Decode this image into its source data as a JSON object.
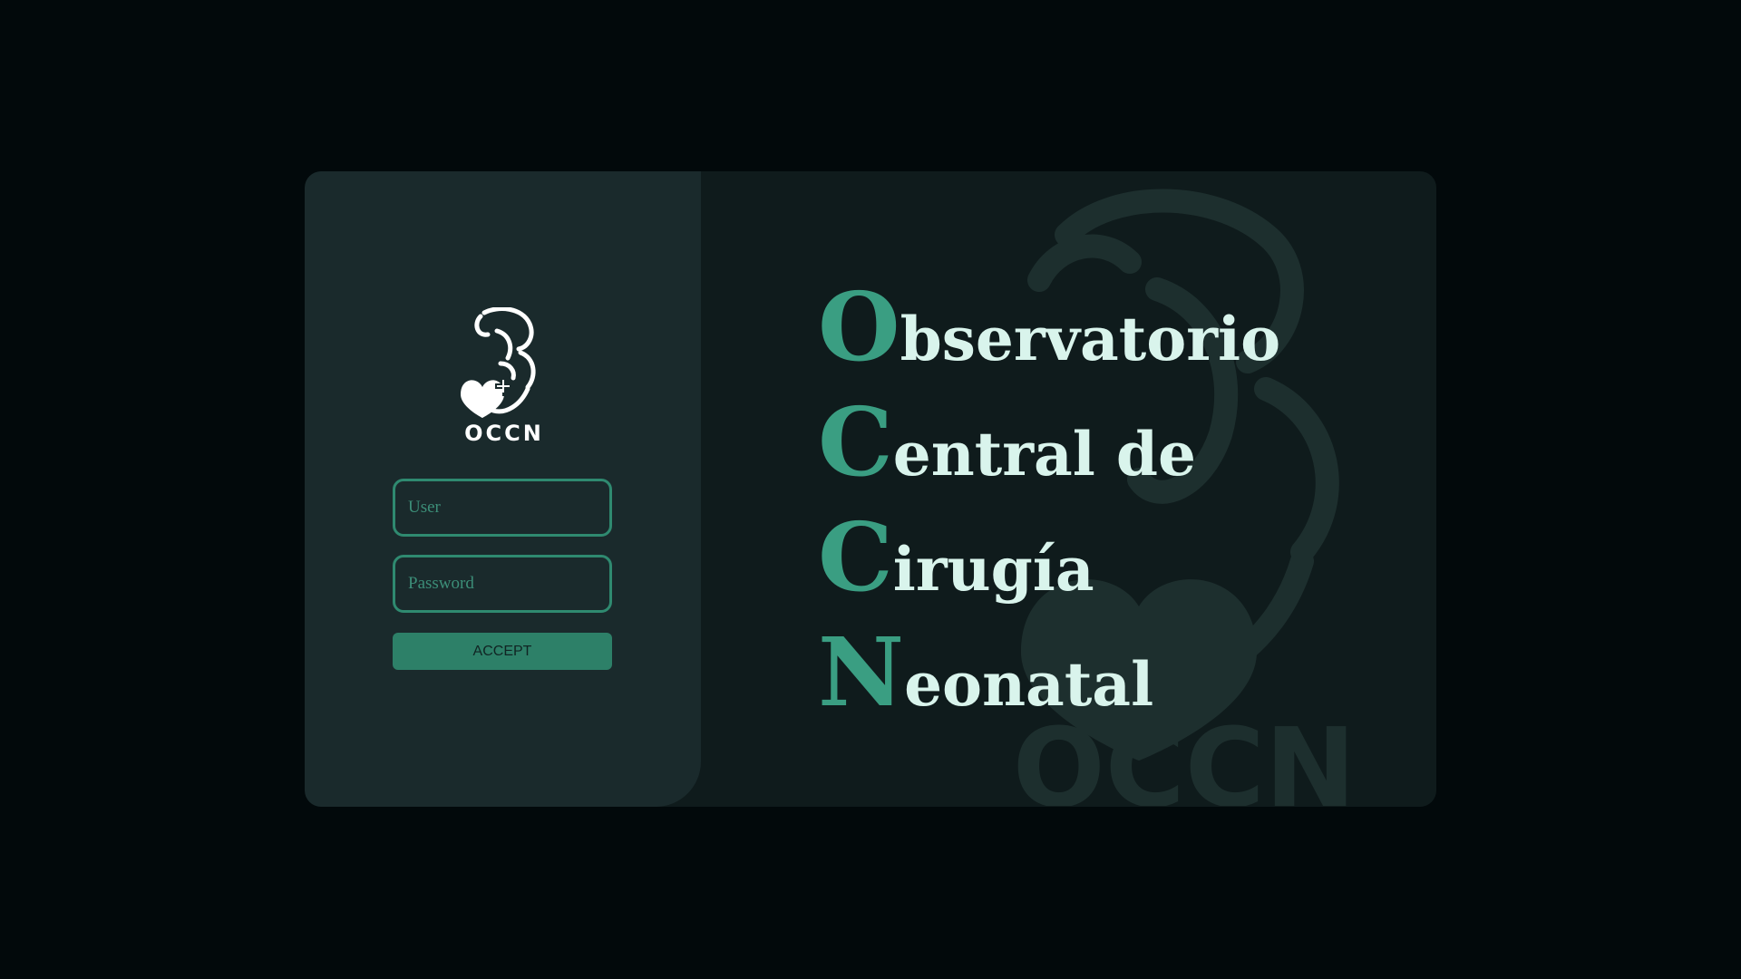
{
  "login": {
    "logo_text": "OCCN",
    "user_placeholder": "User",
    "password_placeholder": "Password",
    "accept_label": "ACCEPT"
  },
  "title": {
    "lines": [
      {
        "initial": "O",
        "rest": "bservatorio"
      },
      {
        "initial": "C",
        "rest": "entral de"
      },
      {
        "initial": "C",
        "rest": "irugía"
      },
      {
        "initial": "N",
        "rest": "eonatal"
      }
    ]
  },
  "watermark": {
    "text": "OCCN"
  },
  "colors": {
    "background": "#02090b",
    "card": "#0f1b1c",
    "panel": "#1a2a2c",
    "accent": "#2f8a70",
    "initial": "#3a9e82",
    "title_text": "#d9f4ec"
  },
  "icons": {
    "logo": "mother-baby-heart-logo"
  }
}
